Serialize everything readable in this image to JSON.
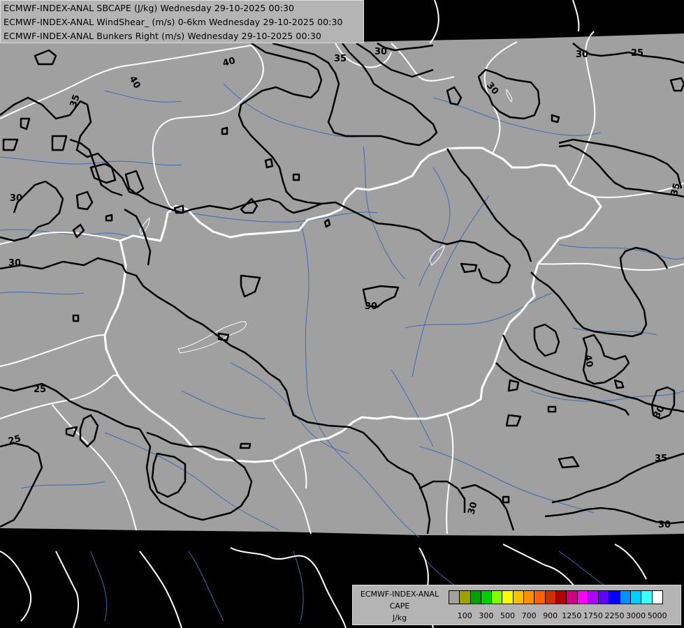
{
  "title_lines": [
    "ECMWF-INDEX-ANAL SBCAPE (J/kg) Wednesday 29-10-2025 00:30",
    "ECMWF-INDEX-ANAL WindShear_ (m/s) 0-6km Wednesday 29-10-2025 00:30",
    "ECMWF-INDEX-ANAL Bunkers Right (m/s) Wednesday 29-10-2025 00:30"
  ],
  "legend": {
    "title_lines": [
      "ECMWF-INDEX-ANAL",
      "CAPE",
      "J/kg"
    ],
    "colors": [
      "#a0a0a0",
      "#a0a000",
      "#00a000",
      "#00d000",
      "#80ff00",
      "#ffff00",
      "#ffc000",
      "#ff9000",
      "#ff6000",
      "#d03000",
      "#b00000",
      "#d00080",
      "#ff00ff",
      "#b000ff",
      "#6000ff",
      "#0000ff",
      "#0090ff",
      "#00d0ff",
      "#40ffff",
      "#ffffff"
    ],
    "ticks": [
      "100",
      "300",
      "500",
      "700",
      "900",
      "1250",
      "1750",
      "2250",
      "3000",
      "5000"
    ]
  },
  "map_colors": {
    "background": "#000000",
    "domain_fill": "#a0a0a0",
    "contour": "#000000",
    "country_border": "#ffffff",
    "river": "#3d6bb4"
  },
  "contour_labels": [
    "40",
    "35",
    "30",
    "35",
    "30",
    "25",
    "35",
    "30",
    "35",
    "30",
    "30",
    "30",
    "25",
    "25",
    "30",
    "40",
    "30",
    "35",
    "30",
    "30"
  ]
}
